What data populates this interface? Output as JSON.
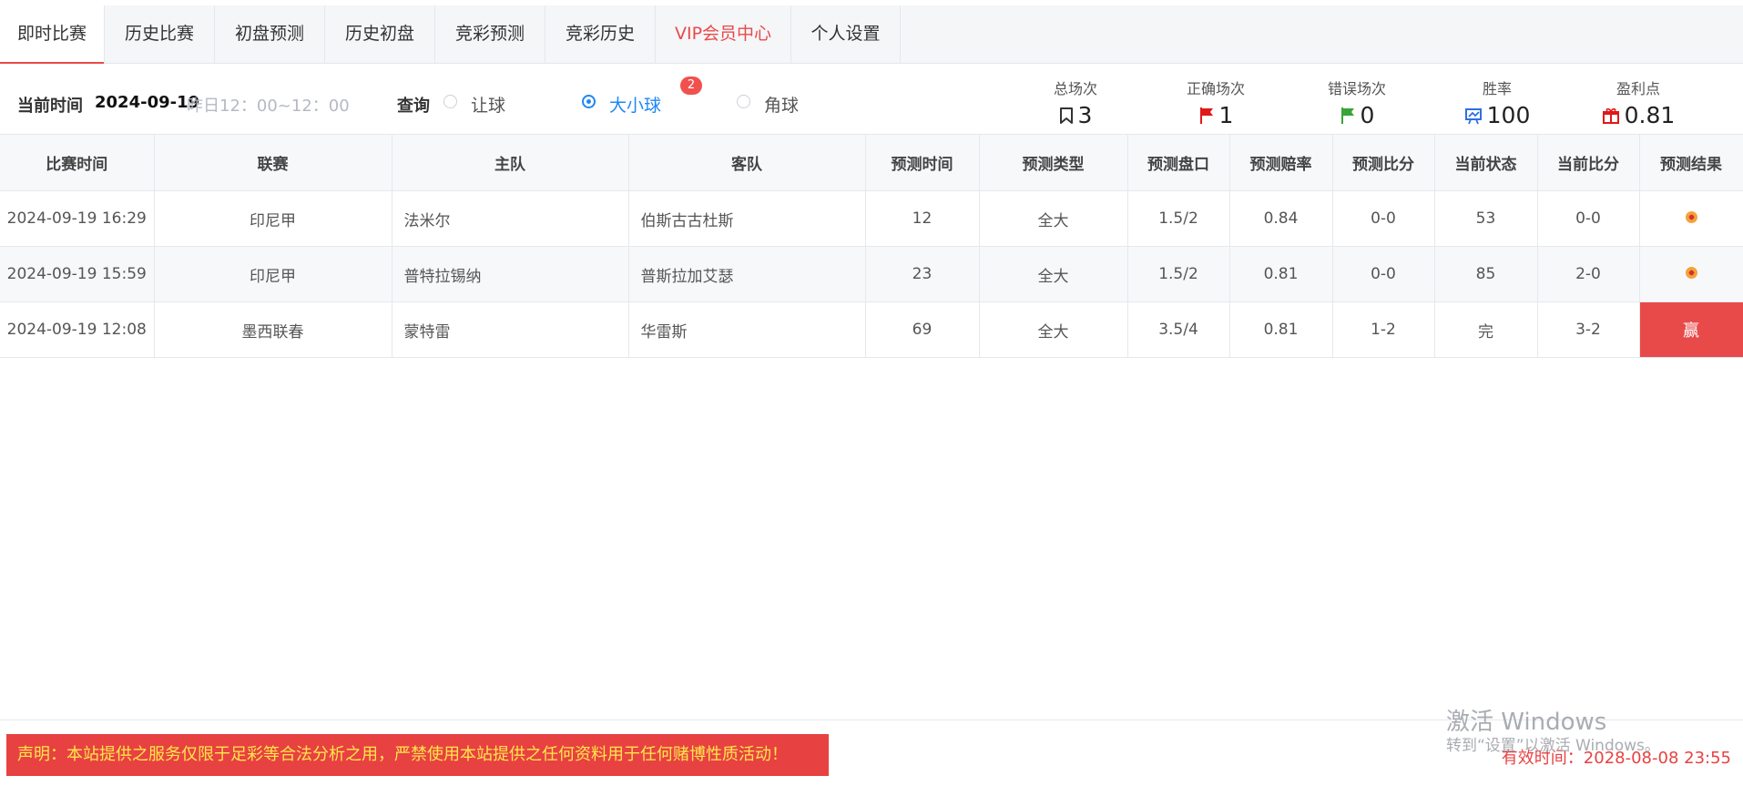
{
  "tabs": [
    {
      "label": "即时比赛"
    },
    {
      "label": "历史比赛"
    },
    {
      "label": "初盘预测"
    },
    {
      "label": "历史初盘"
    },
    {
      "label": "竞彩预测"
    },
    {
      "label": "竞彩历史"
    },
    {
      "label": "VIP会员中心"
    },
    {
      "label": "个人设置"
    }
  ],
  "active_tab": "即时比赛",
  "query": {
    "current_time_label": "当前时间",
    "date": "2024-09-19",
    "range": "昨日12：00~12：00",
    "query_label": "查询",
    "options": [
      {
        "label": "让球",
        "checked": false
      },
      {
        "label": "大小球",
        "checked": true
      },
      {
        "label": "角球",
        "checked": false
      }
    ],
    "badge": "2"
  },
  "stats": [
    {
      "label": "总场次",
      "value": "3",
      "icon": "bookmark-icon",
      "color": "#333333"
    },
    {
      "label": "正确场次",
      "value": "1",
      "icon": "red-flag-icon",
      "color": "#e01818"
    },
    {
      "label": "错误场次",
      "value": "0",
      "icon": "green-flag-icon",
      "color": "#3aa33a"
    },
    {
      "label": "胜率",
      "value": "100",
      "icon": "chart-icon",
      "color": "#2f6fe0"
    },
    {
      "label": "盈利点",
      "value": "0.81",
      "icon": "gift-icon",
      "color": "#e01818"
    }
  ],
  "table": {
    "headers": [
      "比赛时间",
      "联赛",
      "主队",
      "客队",
      "预测时间",
      "预测类型",
      "预测盘口",
      "预测赔率",
      "预测比分",
      "当前状态",
      "当前比分",
      "预测结果"
    ],
    "rows": [
      {
        "time": "2024-09-19 16:29",
        "league": "印尼甲",
        "home": "法米尔",
        "away": "伯斯古古杜斯",
        "pred_time": "12",
        "pred_type": "全大",
        "handicap": "1.5/2",
        "odds": "0.84",
        "pred_score": "0-0",
        "status": "53",
        "score": "0-0",
        "result": "",
        "result_icon": "ball-icon"
      },
      {
        "time": "2024-09-19 15:59",
        "league": "印尼甲",
        "home": "普特拉锡纳",
        "away": "普斯拉加艾瑟",
        "pred_time": "23",
        "pred_type": "全大",
        "handicap": "1.5/2",
        "odds": "0.81",
        "pred_score": "0-0",
        "status": "85",
        "score": "2-0",
        "result": "",
        "result_icon": "ball-icon"
      },
      {
        "time": "2024-09-19 12:08",
        "league": "墨西联春",
        "home": "蒙特雷",
        "away": "华雷斯",
        "pred_time": "69",
        "pred_type": "全大",
        "handicap": "3.5/4",
        "odds": "0.81",
        "pred_score": "1-2",
        "status": "完",
        "score": "3-2",
        "result": "赢",
        "result_icon": ""
      }
    ]
  },
  "footer": {
    "notice": "声明：本站提供之服务仅限于足彩等合法分析之用，严禁使用本站提供之任何资料用于任何赌博性质活动！",
    "valid_label": "有效时间：",
    "valid_value": "2028-08-08 23:55"
  },
  "watermark": {
    "line1": "激活 Windows",
    "line2": "转到“设置”以激活 Windows。"
  },
  "colors": {
    "accent_red": "#e84a4a",
    "radio_blue": "#1e88f5",
    "notice_text": "#ffe74a"
  }
}
